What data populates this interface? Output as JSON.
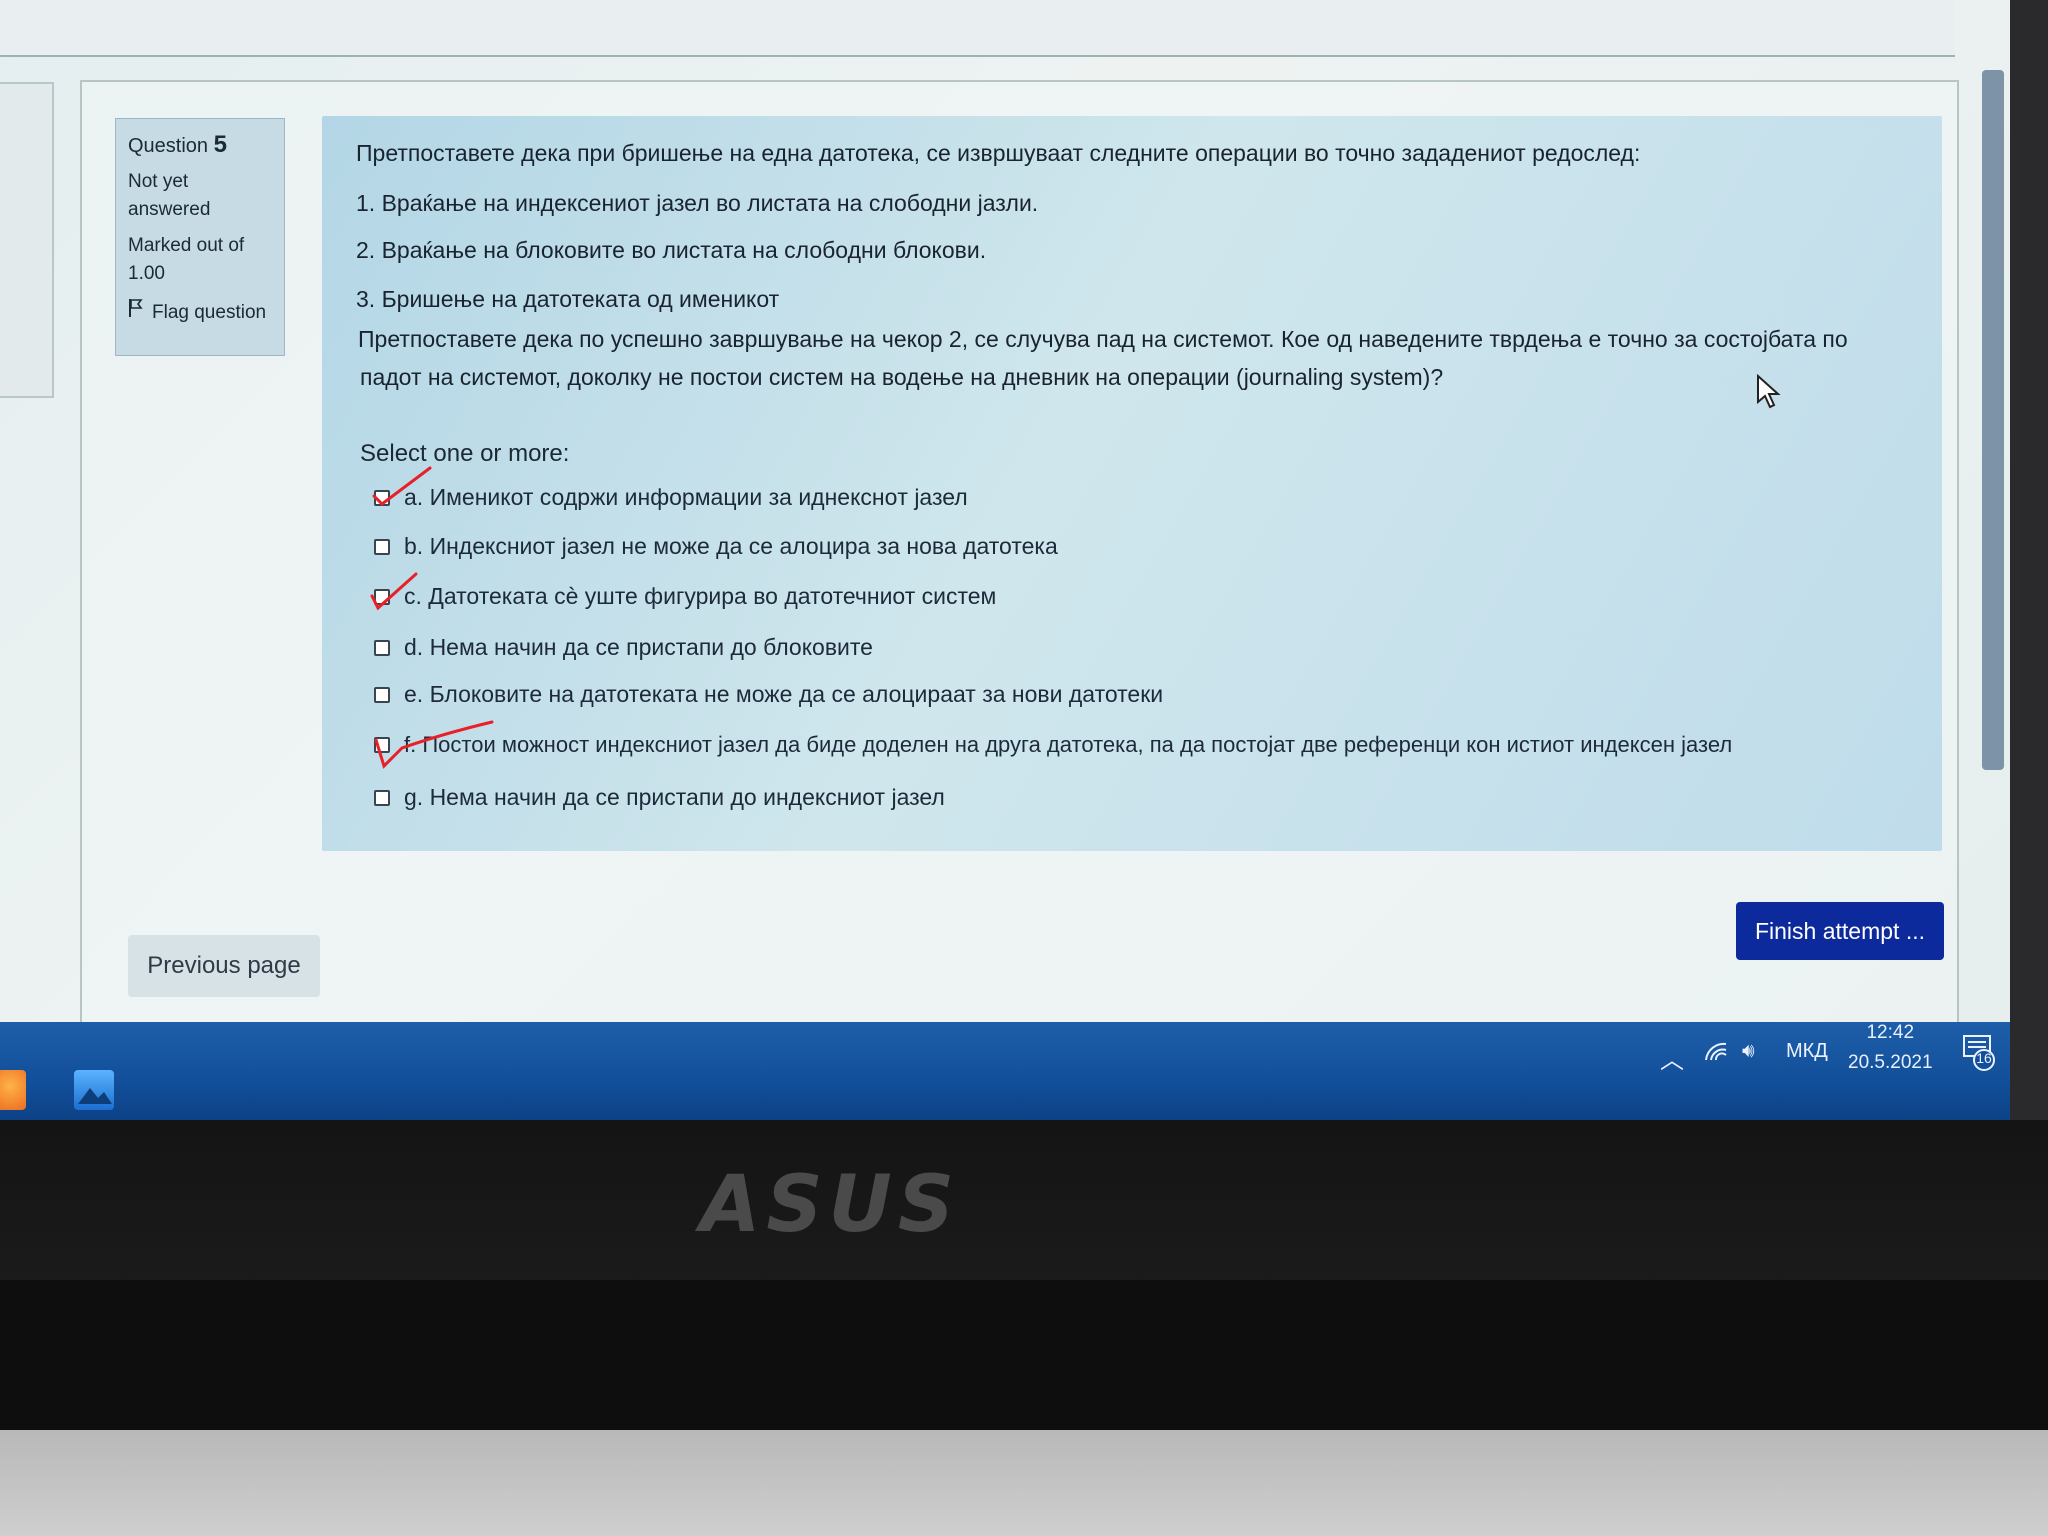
{
  "question_info": {
    "label": "Question",
    "number": "5",
    "status": "Not yet answered",
    "marks": "Marked out of 1.00",
    "flag": "Flag question"
  },
  "question": {
    "intro": "Претпоставете дека при бришење на една датотека, се извршуваат следните операции во точно зададениот редослед:",
    "step1": "1. Враќање на индексениот јазел во листата на слободни јазли.",
    "step2": "2. Враќање на блоковите во листата на слободни блокови.",
    "step3": "3. Бришење на датотеката од имeникот",
    "prompt_line1": "Претпоставете дека по успешно завршување на чекор 2, се случува пад на системот. Кое од наведените тврдења е точно за состојбата по",
    "prompt_line2": "падот на системот, доколку не постои систем на водење на дневник на операции (journaling system)?",
    "select_label": "Select one or more:"
  },
  "options": [
    {
      "text": "a. Именикот содржи информации за иднекснoт јазел",
      "checked": false,
      "pen_mark": true
    },
    {
      "text": "b. Индексниот јазел не може да се алоцира за нова датотека",
      "checked": false,
      "pen_mark": false
    },
    {
      "text": "c. Датотеката сè уште фигурира во датотечниот систем",
      "checked": false,
      "pen_mark": true
    },
    {
      "text": "d. Нема начин да се пристапи до блоковите",
      "checked": false,
      "pen_mark": false
    },
    {
      "text": "e. Блоковите на датотеката не може да се алоцираат за нови датотеки",
      "checked": false,
      "pen_mark": false
    },
    {
      "text": "f. Постои можност индексниот јазел да биде доделен на друга датотека, па да постојат две референци кон истиот индексен јазел",
      "checked": false,
      "pen_mark": true
    },
    {
      "text": "g. Нема начин да се пристапи до индексниот јазел",
      "checked": false,
      "pen_mark": false
    }
  ],
  "nav": {
    "previous": "Previous page",
    "finish": "Finish attempt ..."
  },
  "taskbar": {
    "language": "МКД",
    "time": "12:42",
    "date": "20.5.2021",
    "notifications": "16"
  },
  "device": {
    "brand": "ASUS"
  },
  "colors": {
    "question_bg": "#b3d6e6",
    "info_bg": "#c6dbe4",
    "finish_button": "#0d2a9c",
    "taskbar": "#1e5ea8",
    "pen_mark": "#e8202a"
  }
}
